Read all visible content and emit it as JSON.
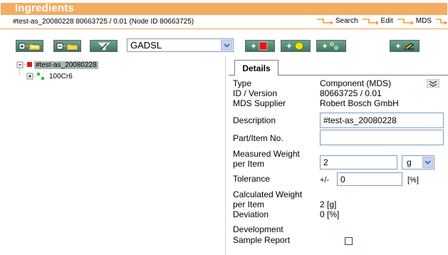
{
  "header": {
    "title": "Ingredients",
    "subtitle": "#test-as_20080228 80663725 / 0.01 (Node ID 80663725)",
    "crumbs": [
      "Search",
      "Edit",
      "MDS"
    ]
  },
  "toolbar": {
    "select_value": "GADSL"
  },
  "tree": {
    "root_label": "#test-as_20080228",
    "child_label": "100Cr6"
  },
  "details": {
    "tab_label": "Details",
    "type_label": "Type",
    "type_value": "Component (MDS)",
    "id_label": "ID / Version",
    "id_value": "80663725 / 0.01",
    "supplier_label": "MDS Supplier",
    "supplier_value": "Robert Bosch GmbH",
    "description_label": "Description",
    "description_value": "#test-as_20080228",
    "part_label": "Part/Item No.",
    "part_value": "",
    "measured_label_1": "Measured Weight",
    "measured_label_2": "per Item",
    "measured_value": "2",
    "measured_unit": "g",
    "tolerance_label": "Tolerance",
    "tolerance_prefix": "+/-",
    "tolerance_value": "0",
    "tolerance_unit": "[%]",
    "calculated_label_1": "Calculated Weight",
    "calculated_label_2": "per Item",
    "calculated_value": "2 [g]",
    "deviation_label": "Deviation",
    "deviation_value": "0 [%]",
    "devreport_label_1": "Development",
    "devreport_label_2": "Sample Report"
  },
  "colors": {
    "title_bar": "#f4ab63",
    "button_green": "#4d826f",
    "red_square": "#e8141b",
    "yellow_circle": "#f4e000"
  }
}
